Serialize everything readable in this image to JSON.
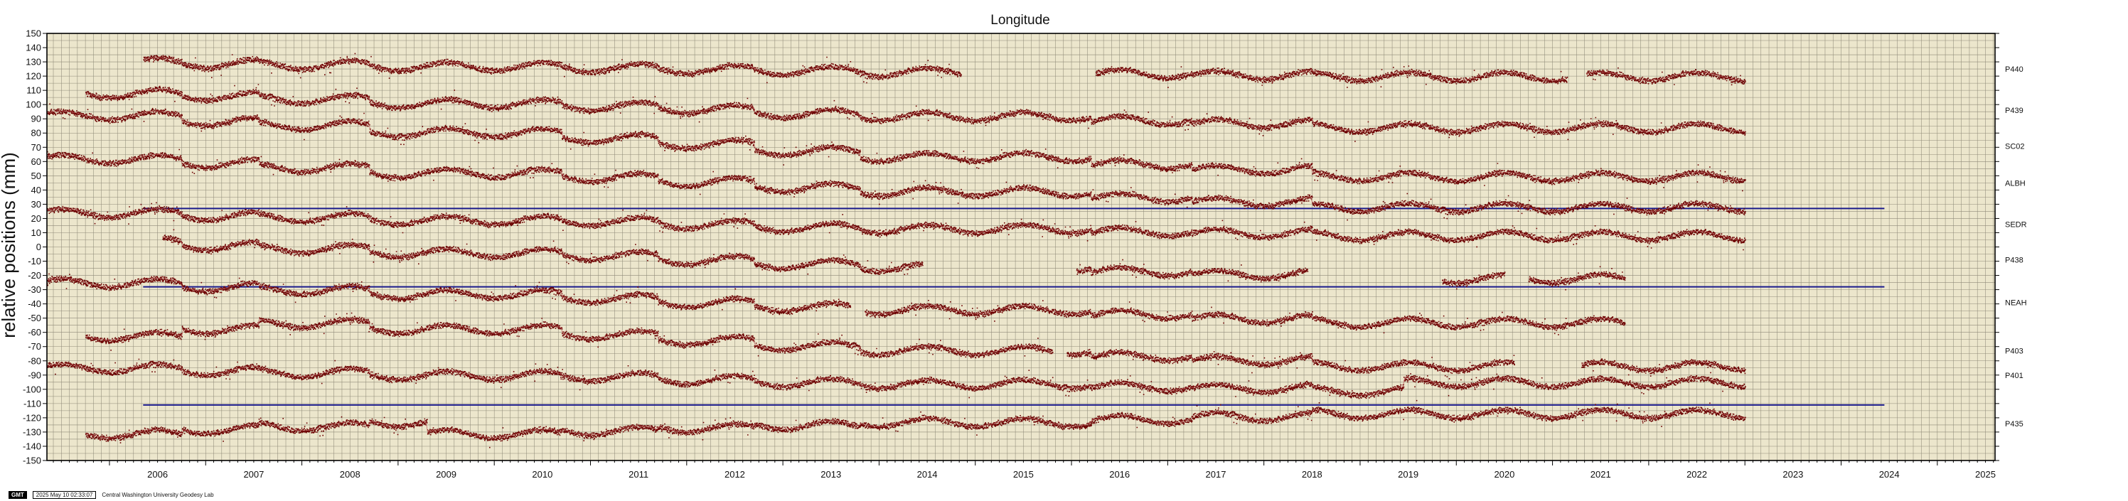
{
  "chart_data": {
    "type": "scatter",
    "title": "Longitude",
    "ylabel": "relative positions (mm)",
    "xlabel": "",
    "xlim": [
      2005.35,
      2025.6
    ],
    "ylim": [
      -150,
      150
    ],
    "x_tick_labels": [
      "2006",
      "2007",
      "2008",
      "2009",
      "2010",
      "2011",
      "2012",
      "2013",
      "2014",
      "2015",
      "2016",
      "2017",
      "2018",
      "2019",
      "2020",
      "2021",
      "2022",
      "2023",
      "2024",
      "2025"
    ],
    "y_ticks": [
      -150,
      -140,
      -130,
      -120,
      -110,
      -100,
      -90,
      -80,
      -70,
      -60,
      -50,
      -40,
      -30,
      -20,
      -10,
      0,
      10,
      20,
      30,
      40,
      50,
      60,
      70,
      80,
      90,
      100,
      110,
      120,
      130,
      140,
      150
    ],
    "grid": true,
    "background": "#ece6cc",
    "marker_color": "#6b0000",
    "model_line_color": "#c06060",
    "series": [
      {
        "name": "P440",
        "offset": 125,
        "segments": [
          [
            2006.35,
            2014.85
          ],
          [
            2016.25,
            2021.15
          ],
          [
            2021.35,
            2023.0
          ]
        ],
        "steps": [
          [
            2006.75,
            -1
          ],
          [
            2007.55,
            -1
          ],
          [
            2008.7,
            -1
          ],
          [
            2010.7,
            -1
          ],
          [
            2011.7,
            -1
          ],
          [
            2012.7,
            -1
          ],
          [
            2013.8,
            -1
          ],
          [
            2016.2,
            -1
          ],
          [
            2017.25,
            -1
          ],
          [
            2018.5,
            -1
          ]
        ]
      },
      {
        "name": "P439",
        "offset": 96,
        "segments": [
          [
            2005.75,
            2023.0
          ]
        ],
        "steps": [
          [
            2006.75,
            -2
          ],
          [
            2007.55,
            -2
          ],
          [
            2008.7,
            -3
          ],
          [
            2010.7,
            -2
          ],
          [
            2011.7,
            -2
          ],
          [
            2012.7,
            -3
          ],
          [
            2013.8,
            -2
          ],
          [
            2016.2,
            -3
          ],
          [
            2017.25,
            -2
          ],
          [
            2018.5,
            -3
          ]
        ]
      },
      {
        "name": "SC02",
        "offset": 71,
        "segments": [
          [
            2005.35,
            2023.0
          ]
        ],
        "steps": [
          [
            2006.75,
            -4
          ],
          [
            2007.55,
            -3
          ],
          [
            2008.7,
            -5
          ],
          [
            2010.7,
            -4
          ],
          [
            2011.7,
            -4
          ],
          [
            2012.7,
            -5
          ],
          [
            2013.8,
            -4
          ],
          [
            2016.2,
            -5
          ],
          [
            2017.25,
            -4
          ],
          [
            2018.5,
            -5
          ]
        ]
      },
      {
        "name": "ALBH",
        "offset": 45,
        "segments": [
          [
            2005.35,
            2023.0
          ]
        ],
        "steps": [
          [
            2006.75,
            -3
          ],
          [
            2007.55,
            -3
          ],
          [
            2008.7,
            -4
          ],
          [
            2010.7,
            -3
          ],
          [
            2011.7,
            -3
          ],
          [
            2012.7,
            -4
          ],
          [
            2013.8,
            -3
          ],
          [
            2016.2,
            -4
          ],
          [
            2017.25,
            -3
          ],
          [
            2018.5,
            -4
          ]
        ]
      },
      {
        "name": "SEDR",
        "offset": 16,
        "segments": [
          [
            2005.35,
            2023.0
          ]
        ],
        "steps": [
          [
            2006.75,
            -2
          ],
          [
            2007.55,
            -1
          ],
          [
            2008.7,
            -2
          ],
          [
            2010.7,
            -1
          ],
          [
            2011.7,
            -2
          ],
          [
            2012.7,
            -2
          ],
          [
            2013.8,
            -1
          ],
          [
            2016.2,
            -2
          ],
          [
            2017.25,
            -1
          ],
          [
            2018.5,
            -2
          ]
        ]
      },
      {
        "name": "P438",
        "offset": -9,
        "segments": [
          [
            2006.55,
            2014.45
          ],
          [
            2016.05,
            2018.45
          ],
          [
            2019.85,
            2020.5
          ],
          [
            2020.75,
            2021.75
          ]
        ],
        "steps": [
          [
            2006.75,
            -3
          ],
          [
            2007.55,
            -2
          ],
          [
            2008.7,
            -3
          ],
          [
            2010.7,
            -2
          ],
          [
            2011.7,
            -3
          ],
          [
            2012.7,
            -3
          ],
          [
            2013.8,
            -2
          ],
          [
            2016.2,
            -3
          ],
          [
            2017.25,
            -2
          ],
          [
            2018.5,
            -3
          ]
        ]
      },
      {
        "name": "NEAH",
        "offset": -39,
        "segments": [
          [
            2005.35,
            2013.7
          ],
          [
            2013.85,
            2021.75
          ]
        ],
        "steps": [
          [
            2006.75,
            -3
          ],
          [
            2007.55,
            -2
          ],
          [
            2008.7,
            -3
          ],
          [
            2010.7,
            -3
          ],
          [
            2011.7,
            -3
          ],
          [
            2012.7,
            -3
          ],
          [
            2013.8,
            -2
          ],
          [
            2016.2,
            -3
          ],
          [
            2017.25,
            -3
          ],
          [
            2018.5,
            -3
          ]
        ]
      },
      {
        "name": "P403",
        "offset": -73,
        "segments": [
          [
            2005.75,
            2015.8
          ],
          [
            2015.95,
            2020.6
          ],
          [
            2021.3,
            2023.0
          ]
        ],
        "steps": [
          [
            2006.75,
            5
          ],
          [
            2007.55,
            4
          ],
          [
            2008.7,
            -4
          ],
          [
            2010.7,
            -4
          ],
          [
            2011.7,
            -4
          ],
          [
            2012.7,
            -4
          ],
          [
            2013.8,
            -3
          ],
          [
            2016.2,
            -4
          ],
          [
            2017.25,
            -3
          ],
          [
            2018.5,
            -4
          ]
        ]
      },
      {
        "name": "P401",
        "offset": -90,
        "segments": [
          [
            2005.35,
            2023.0
          ]
        ],
        "steps": [
          [
            2006.75,
            -2
          ],
          [
            2007.55,
            -1
          ],
          [
            2008.7,
            -2
          ],
          [
            2010.7,
            -1
          ],
          [
            2011.7,
            -2
          ],
          [
            2012.7,
            -2
          ],
          [
            2013.8,
            -1
          ],
          [
            2016.2,
            -2
          ],
          [
            2017.25,
            -1
          ],
          [
            2018.5,
            -2
          ],
          [
            2019.45,
            6
          ]
        ]
      },
      {
        "name": "P435",
        "offset": -124,
        "segments": [
          [
            2005.75,
            2023.0
          ]
        ],
        "steps": [
          [
            2006.75,
            3
          ],
          [
            2007.55,
            2
          ],
          [
            2008.7,
            3
          ],
          [
            2009.3,
            -8
          ],
          [
            2010.7,
            2
          ],
          [
            2011.7,
            2
          ],
          [
            2012.7,
            2
          ],
          [
            2013.8,
            2
          ],
          [
            2016.2,
            2
          ],
          [
            2017.25,
            2
          ],
          [
            2018.5,
            2
          ]
        ]
      }
    ],
    "reference_lines": [
      {
        "y": 27,
        "x0": 2006.35,
        "x1": 2024.45,
        "color": "#1a1a8c"
      },
      {
        "y": -28,
        "x0": 2006.35,
        "x1": 2024.45,
        "color": "#1a1a8c"
      },
      {
        "y": -111,
        "x0": 2006.35,
        "x1": 2024.45,
        "color": "#1a1a8c"
      }
    ]
  },
  "footer": {
    "logo": "GMT",
    "timestamp": "2025 May 10 02:33:07",
    "credit": "Central Washington University Geodesy Lab"
  }
}
